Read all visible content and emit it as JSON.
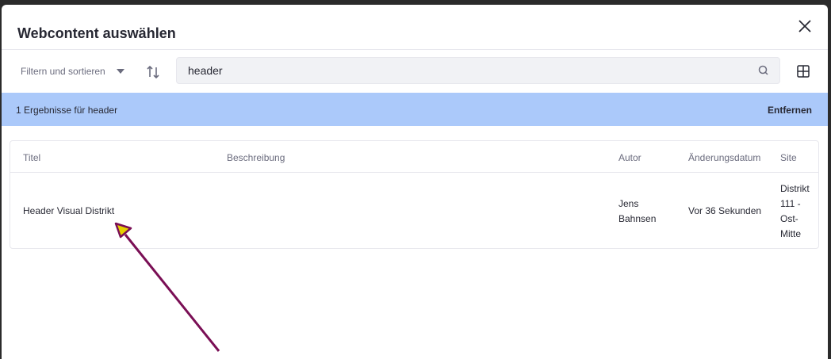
{
  "modal": {
    "title": "Webcontent auswählen"
  },
  "toolbar": {
    "filter_label": "Filtern und sortieren",
    "search_value": "header"
  },
  "result_bar": {
    "text": "1 Ergebnisse für header",
    "remove_label": "Entfernen",
    "color": "#abc9fa"
  },
  "table": {
    "headers": [
      "Titel",
      "Beschreibung",
      "Autor",
      "Änderungsdatum",
      "Site"
    ],
    "rows": [
      {
        "title": "Header Visual Distrikt",
        "description": "",
        "author": [
          "Jens",
          "Bahnsen"
        ],
        "modified": "Vor 36 Sekunden",
        "site": [
          "Distrikt",
          "111 -",
          "Ost-",
          "Mitte"
        ]
      }
    ]
  },
  "annotation": {
    "arrow_color": "#7a0f55",
    "arrow_head_color": "#e6d000"
  }
}
